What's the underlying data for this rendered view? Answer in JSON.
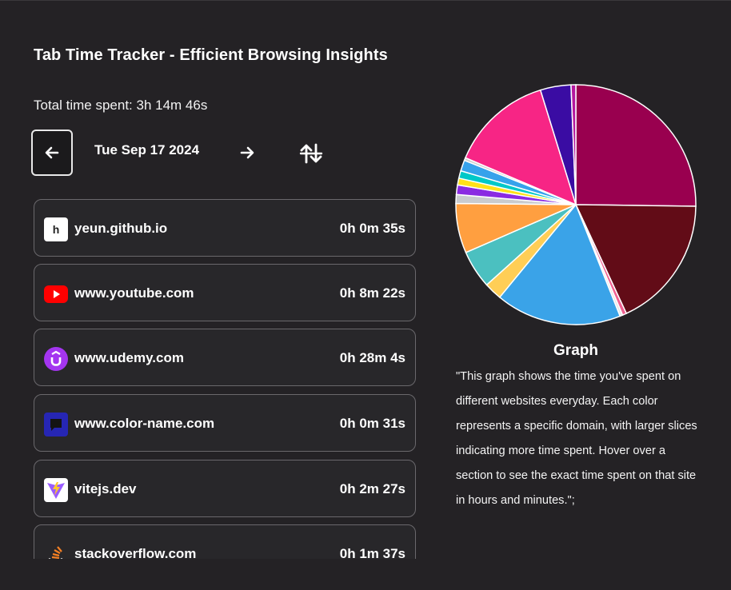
{
  "header": {
    "title": "Tab Time Tracker - Efficient Browsing Insights",
    "total_time": "Total time spent: 3h 14m 46s"
  },
  "date_nav": {
    "date": "Tue Sep 17 2024",
    "prev_icon": "arrow-left-icon",
    "next_icon": "arrow-right-icon",
    "sort_icon": "sort-arrows-icon"
  },
  "sites": [
    {
      "domain": "yeun.github.io",
      "time": "0h 0m 35s",
      "icon": "github-pages-icon",
      "color": "#ffffff"
    },
    {
      "domain": "www.youtube.com",
      "time": "0h 8m 22s",
      "icon": "youtube-icon",
      "color": "#ff0000"
    },
    {
      "domain": "www.udemy.com",
      "time": "0h 28m 4s",
      "icon": "udemy-icon",
      "color": "#a435f0"
    },
    {
      "domain": "www.color-name.com",
      "time": "0h 0m 31s",
      "icon": "color-name-icon",
      "color": "#2a2ab8"
    },
    {
      "domain": "vitejs.dev",
      "time": "0h 2m 27s",
      "icon": "vite-icon",
      "color": "#9a5cff"
    },
    {
      "domain": "stackoverflow.com",
      "time": "0h 1m 37s",
      "icon": "stackoverflow-icon",
      "color": "#f48024"
    }
  ],
  "graph": {
    "title": "Graph",
    "description": "\"This graph shows the time you've spent on different websites everyday. Each color represents a specific domain, with larger slices indicating more time spent. Hover over a section to see the exact time spent on that site in hours and minutes.\";"
  },
  "chart_data": {
    "type": "pie",
    "values": [
      27.5,
      19.5,
      0.6,
      0.4,
      18.5,
      2.6,
      5.6,
      7.3,
      1.3,
      1.4,
      1.0,
      1.1,
      1.6,
      0.4,
      15.1,
      4.5,
      0.7
    ],
    "colors": [
      "#99004f",
      "#620c17",
      "#f06292",
      "#e8e8e8",
      "#3aa3e8",
      "#ffce56",
      "#4bc0c0",
      "#ff9f40",
      "#c9cbcf",
      "#8a2be2",
      "#ffe119",
      "#00c8c8",
      "#36a2eb",
      "#d0d0d0",
      "#f72585",
      "#3a0ca3",
      "#b5179e"
    ]
  }
}
